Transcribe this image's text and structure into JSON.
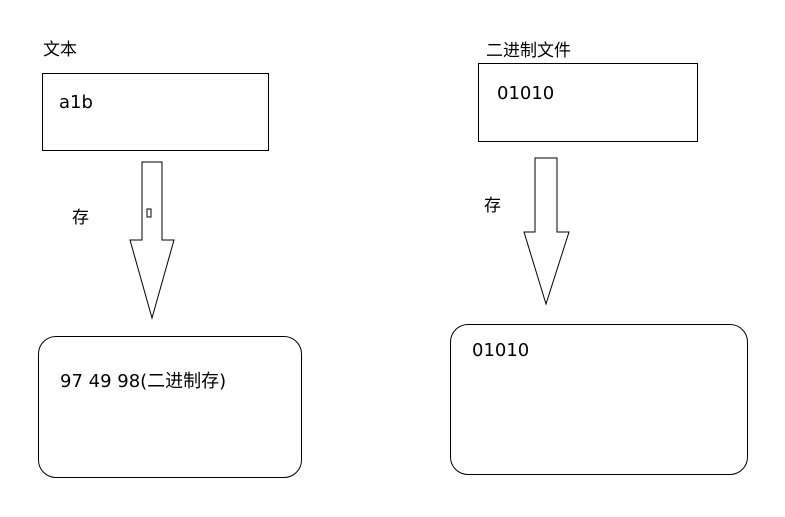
{
  "left": {
    "title": "文本",
    "source_box": "a1b",
    "action": "存",
    "result_box": "97  49 98(二进制存)"
  },
  "right": {
    "title": "二进制文件",
    "source_box": "01010",
    "action": "存",
    "result_box": "01010"
  }
}
